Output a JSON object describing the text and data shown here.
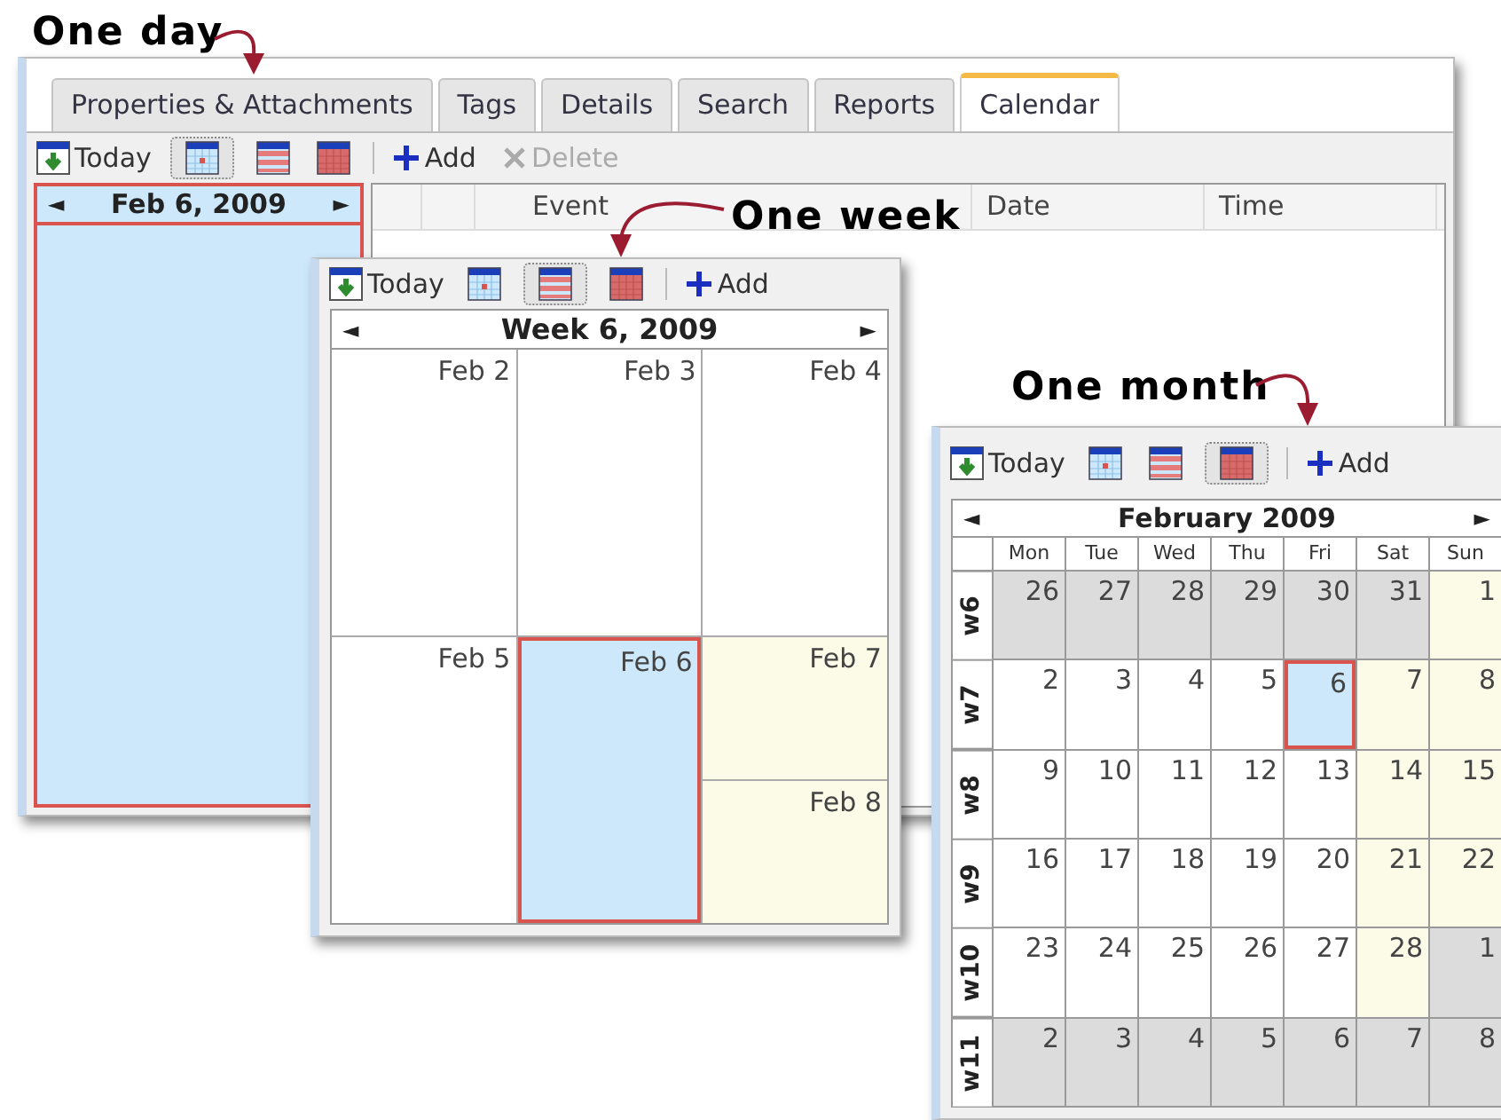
{
  "main_window": {
    "annotation": "One day",
    "tabs": [
      {
        "label": "Properties & Attachments",
        "selected": false
      },
      {
        "label": "Tags",
        "selected": false
      },
      {
        "label": "Details",
        "selected": false
      },
      {
        "label": "Search",
        "selected": false
      },
      {
        "label": "Reports",
        "selected": false
      },
      {
        "label": "Calendar",
        "selected": true
      }
    ],
    "toolbar": {
      "today": "Today",
      "views": [
        {
          "kind": "day",
          "selected": true
        },
        {
          "kind": "week",
          "selected": false
        },
        {
          "kind": "month",
          "selected": false
        }
      ],
      "add": "Add",
      "delete": {
        "label": "Delete",
        "disabled": true
      }
    },
    "day_view": {
      "prev": "◄",
      "title": "Feb 6, 2009",
      "next": "►",
      "selected": true
    },
    "table": {
      "columns": [
        "Event",
        "Date",
        "Time"
      ]
    }
  },
  "week_window": {
    "annotation": "One week",
    "toolbar": {
      "today": "Today",
      "views": [
        {
          "kind": "day",
          "selected": false
        },
        {
          "kind": "week",
          "selected": true
        },
        {
          "kind": "month",
          "selected": false
        }
      ],
      "add": "Add"
    },
    "prev": "◄",
    "title": "Week 6, 2009",
    "next": "►",
    "days": [
      {
        "label": "Feb 2",
        "kind": "weekday",
        "selected": false
      },
      {
        "label": "Feb 3",
        "kind": "weekday",
        "selected": false
      },
      {
        "label": "Feb 4",
        "kind": "weekday",
        "selected": false
      },
      {
        "label": "Feb 5",
        "kind": "weekday",
        "selected": false
      },
      {
        "label": "Feb 6",
        "kind": "weekday",
        "selected": true
      },
      {
        "label": "Feb 7",
        "kind": "weekend",
        "selected": false
      },
      {
        "label": "Feb 8",
        "kind": "weekend",
        "selected": false
      }
    ]
  },
  "month_window": {
    "annotation": "One month",
    "toolbar": {
      "today": "Today",
      "views": [
        {
          "kind": "day",
          "selected": false
        },
        {
          "kind": "week",
          "selected": false
        },
        {
          "kind": "month",
          "selected": true
        }
      ],
      "add": "Add"
    },
    "prev": "◄",
    "title": "February 2009",
    "next": "►",
    "weekdays": [
      "Mon",
      "Tue",
      "Wed",
      "Thu",
      "Fri",
      "Sat",
      "Sun"
    ],
    "weeks": [
      {
        "label": "w6",
        "days": [
          {
            "day": "26",
            "kind": "outside",
            "selected": false
          },
          {
            "day": "27",
            "kind": "outside",
            "selected": false
          },
          {
            "day": "28",
            "kind": "outside",
            "selected": false
          },
          {
            "day": "29",
            "kind": "outside",
            "selected": false
          },
          {
            "day": "30",
            "kind": "outside",
            "selected": false
          },
          {
            "day": "31",
            "kind": "outside",
            "selected": false
          },
          {
            "day": "1",
            "kind": "weekend",
            "selected": false
          }
        ]
      },
      {
        "label": "w7",
        "days": [
          {
            "day": "2",
            "kind": "weekday",
            "selected": false
          },
          {
            "day": "3",
            "kind": "weekday",
            "selected": false
          },
          {
            "day": "4",
            "kind": "weekday",
            "selected": false
          },
          {
            "day": "5",
            "kind": "weekday",
            "selected": false
          },
          {
            "day": "6",
            "kind": "weekday",
            "selected": true
          },
          {
            "day": "7",
            "kind": "weekend",
            "selected": false
          },
          {
            "day": "8",
            "kind": "weekend",
            "selected": false
          }
        ]
      },
      {
        "label": "w8",
        "days": [
          {
            "day": "9",
            "kind": "weekday",
            "selected": false
          },
          {
            "day": "10",
            "kind": "weekday",
            "selected": false
          },
          {
            "day": "11",
            "kind": "weekday",
            "selected": false
          },
          {
            "day": "12",
            "kind": "weekday",
            "selected": false
          },
          {
            "day": "13",
            "kind": "weekday",
            "selected": false
          },
          {
            "day": "14",
            "kind": "weekend",
            "selected": false
          },
          {
            "day": "15",
            "kind": "weekend",
            "selected": false
          }
        ]
      },
      {
        "label": "w9",
        "days": [
          {
            "day": "16",
            "kind": "weekday",
            "selected": false
          },
          {
            "day": "17",
            "kind": "weekday",
            "selected": false
          },
          {
            "day": "18",
            "kind": "weekday",
            "selected": false
          },
          {
            "day": "19",
            "kind": "weekday",
            "selected": false
          },
          {
            "day": "20",
            "kind": "weekday",
            "selected": false
          },
          {
            "day": "21",
            "kind": "weekend",
            "selected": false
          },
          {
            "day": "22",
            "kind": "weekend",
            "selected": false
          }
        ]
      },
      {
        "label": "w10",
        "days": [
          {
            "day": "23",
            "kind": "weekday",
            "selected": false
          },
          {
            "day": "24",
            "kind": "weekday",
            "selected": false
          },
          {
            "day": "25",
            "kind": "weekday",
            "selected": false
          },
          {
            "day": "26",
            "kind": "weekday",
            "selected": false
          },
          {
            "day": "27",
            "kind": "weekday",
            "selected": false
          },
          {
            "day": "28",
            "kind": "weekend",
            "selected": false
          },
          {
            "day": "1",
            "kind": "outside",
            "selected": false
          }
        ]
      },
      {
        "label": "w11",
        "days": [
          {
            "day": "2",
            "kind": "outside",
            "selected": false
          },
          {
            "day": "3",
            "kind": "outside",
            "selected": false
          },
          {
            "day": "4",
            "kind": "outside",
            "selected": false
          },
          {
            "day": "5",
            "kind": "outside",
            "selected": false
          },
          {
            "day": "6",
            "kind": "outside",
            "selected": false
          },
          {
            "day": "7",
            "kind": "outside",
            "selected": false
          },
          {
            "day": "8",
            "kind": "outside",
            "selected": false
          }
        ]
      }
    ]
  }
}
